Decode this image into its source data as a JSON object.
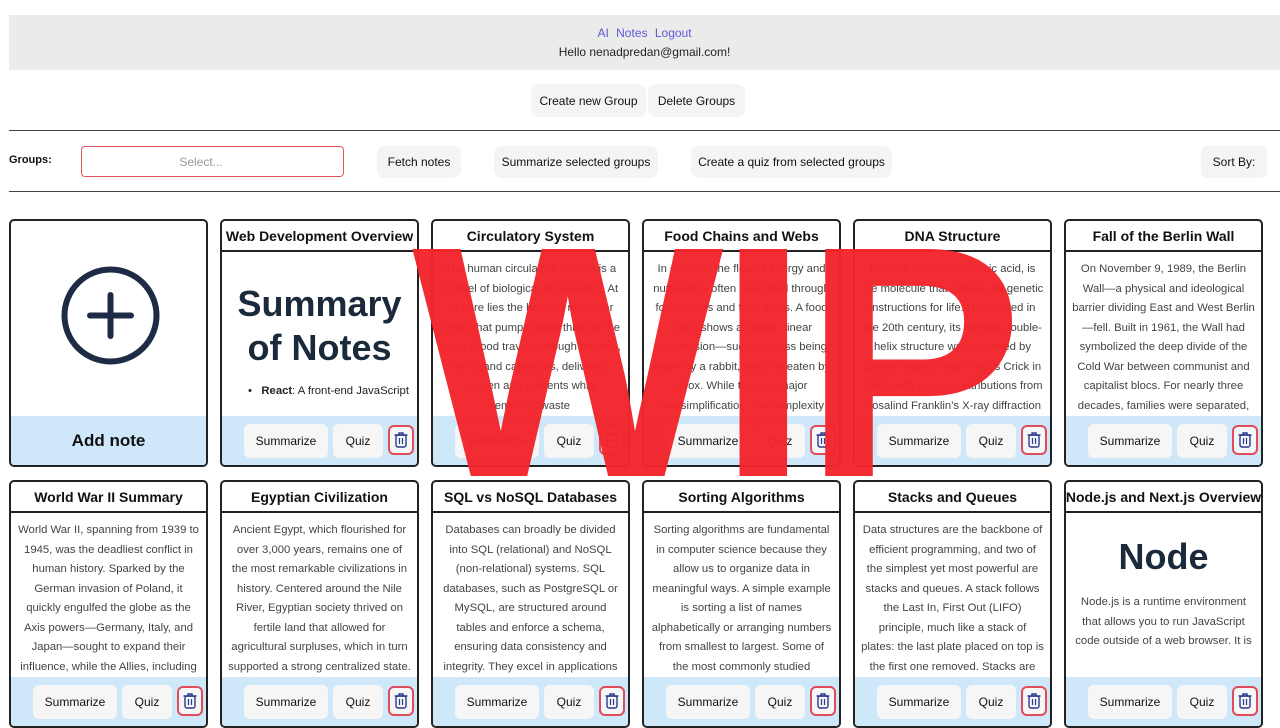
{
  "nav": {
    "links": [
      "AI",
      "Notes",
      "Logout"
    ],
    "greeting": "Hello nenadpredan@gmail.com!"
  },
  "group_actions": {
    "create": "Create new Group",
    "delete": "Delete Groups"
  },
  "toolbar": {
    "groups_label": "Groups:",
    "select_placeholder": "Select...",
    "fetch": "Fetch notes",
    "summarize": "Summarize selected groups",
    "quiz": "Create a quiz from selected groups",
    "sort": "Sort By:"
  },
  "add_note": {
    "label": "Add note"
  },
  "card_actions": {
    "summarize": "Summarize",
    "quiz": "Quiz"
  },
  "notes": [
    {
      "title": "Web Development Overview",
      "heading": "Summary of Notes",
      "bullet_term": "React",
      "bullet_text": ": A front-end JavaScript"
    },
    {
      "title": "Circulatory System",
      "body": "The human circulatory system is a marvel of biological engineering. At its core lies the heart, a muscular organ that pumps blood through the body. Blood travels through arteries, veins, and capillaries, delivering oxygen and nutrients while removing waste"
    },
    {
      "title": "Food Chains and Webs",
      "body": "In ecology, the flow of energy and nutrients is often described through food chains and food webs. A food chain shows a simple, linear progression—such as grass being eaten by a rabbit, which is eaten by a fox. While this is a major oversimplification, the complexity"
    },
    {
      "title": "DNA Structure",
      "body": "DNA, or deoxyribonucleic acid, is the molecule that carries the genetic instructions for life. Discovered in the 20th century, its famous double-helix structure was identified by James Watson and Francis Crick in 1953, with crucial contributions from Rosalind Franklin's X-ray diffraction images."
    },
    {
      "title": "Fall of the Berlin Wall",
      "body": "On November 9, 1989, the Berlin Wall—a physical and ideological barrier dividing East and West Berlin—fell. Built in 1961, the Wall had symbolized the deep divide of the Cold War between communist and capitalist blocs. For nearly three decades, families were separated, and East"
    },
    {
      "title": "World War II Summary",
      "body": "World War II, spanning from 1939 to 1945, was the deadliest conflict in human history. Sparked by the German invasion of Poland, it quickly engulfed the globe as the Axis powers—Germany, Italy, and Japan—sought to expand their influence, while the Allies, including the United States,"
    },
    {
      "title": "Egyptian Civilization",
      "body": "Ancient Egypt, which flourished for over 3,000 years, remains one of the most remarkable civilizations in history. Centered around the Nile River, Egyptian society thrived on fertile land that allowed for agricultural surpluses, which in turn supported a strong centralized state."
    },
    {
      "title": "SQL vs NoSQL Databases",
      "body": "Databases can broadly be divided into SQL (relational) and NoSQL (non-relational) systems. SQL databases, such as PostgreSQL or MySQL, are structured around tables and enforce a schema, ensuring data consistency and integrity. They excel in applications where relationships"
    },
    {
      "title": "Sorting Algorithms",
      "body": "Sorting algorithms are fundamental in computer science because they allow us to organize data in meaningful ways. A simple example is sorting a list of names alphabetically or arranging numbers from smallest to largest. Some of the most commonly studied algorithms include Bubble"
    },
    {
      "title": "Stacks and Queues",
      "body": "Data structures are the backbone of efficient programming, and two of the simplest yet most powerful are stacks and queues. A stack follows the Last In, First Out (LIFO) principle, much like a stack of plates: the last plate placed on top is the first one removed. Stacks are commonly used in function calls,"
    },
    {
      "title": "Node.js and Next.js Overview",
      "heading": "Node",
      "body": "Node.js is a runtime environment that allows you to run JavaScript code outside of a web browser. It is"
    }
  ],
  "watermark": "WIP",
  "colors": {
    "accent_link": "#5b5bd6",
    "footer_bg": "#cfe8f9",
    "danger": "#e04c5a",
    "watermark": "#f2262c"
  }
}
